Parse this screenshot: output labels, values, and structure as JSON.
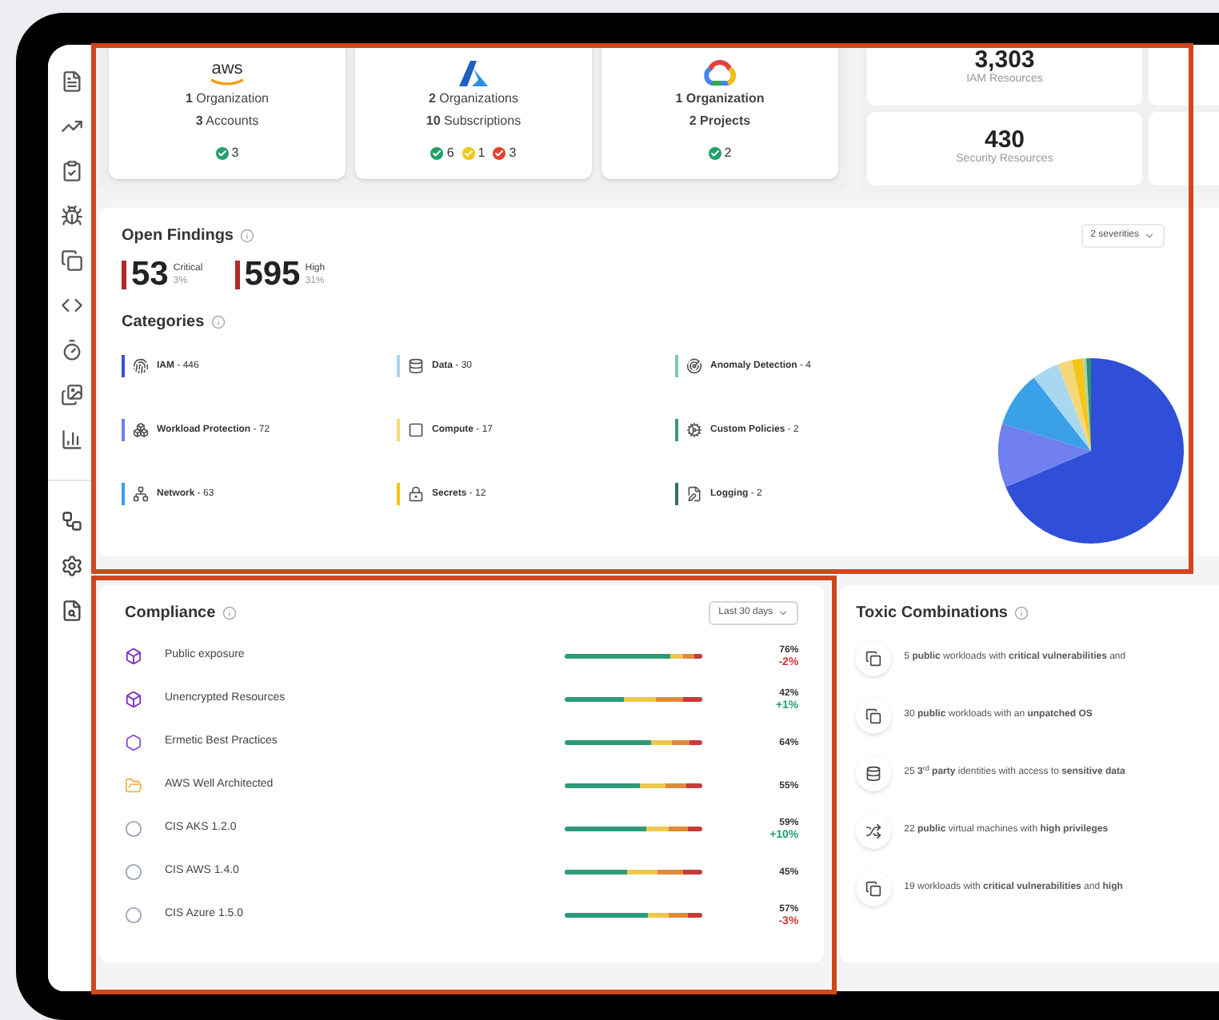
{
  "clouds": [
    {
      "logo_text": "aws",
      "lines": [
        "**1** Organization",
        "**3** Accounts"
      ],
      "statuses": [
        {
          "count": "3",
          "color": "#22a06b"
        }
      ]
    },
    {
      "lines": [
        "**2** Organizations",
        "**10** Subscriptions"
      ],
      "statuses": [
        {
          "count": "6",
          "color": "#22a06b"
        },
        {
          "count": "1",
          "color": "#f5c518"
        },
        {
          "count": "3",
          "color": "#e0412f"
        }
      ]
    },
    {
      "lines": [
        "**1 Organization**",
        "**2 Projects**"
      ],
      "statuses": [
        {
          "count": "2",
          "color": "#22a06b"
        }
      ]
    }
  ],
  "resources": [
    {
      "value": "3,303",
      "label": "IAM Resources"
    },
    {
      "value": "430",
      "label": "Security Resources"
    }
  ],
  "open_findings": {
    "title": "Open Findings",
    "filter": "2 severities",
    "severities": [
      {
        "count": "53",
        "label": "Critical",
        "share": "3%"
      },
      {
        "count": "595",
        "label": "High",
        "share": "31%"
      }
    ],
    "categories_title": "Categories",
    "categories": [
      {
        "label": "**IAM** - 446",
        "color": "#3b4fd8"
      },
      {
        "label": "**Data** - 30",
        "color": "#a8d8f0"
      },
      {
        "label": "**Anomaly Detection** - 4",
        "color": "#7cc9a8"
      },
      {
        "label": "**Workload Protection** - 72",
        "color": "#7080ee"
      },
      {
        "label": "**Compute** - 17",
        "color": "#f5d77a"
      },
      {
        "label": "**Custom Policies** - 2",
        "color": "#3d9a7c"
      },
      {
        "label": "**Network** - 63",
        "color": "#3aa0e8"
      },
      {
        "label": "**Secrets** - 12",
        "color": "#f5c518"
      },
      {
        "label": "**Logging** - 2",
        "color": "#2f6f5f"
      }
    ]
  },
  "compliance": {
    "title": "Compliance",
    "range": "Last 30 days",
    "rows": [
      {
        "name": "Public exposure",
        "level": 0.77,
        "percent": "76%",
        "delta": {
          "text": "-2%",
          "color": "#d33333"
        }
      },
      {
        "name": "Unencrypted Resources",
        "level": 0.43,
        "percent": "42%",
        "delta": {
          "text": "+1%",
          "color": "#22a06b"
        }
      },
      {
        "name": "Ermetic Best Practices",
        "level": 0.63,
        "percent": "64%"
      },
      {
        "name": "AWS Well Architected",
        "level": 0.55,
        "percent": "55%"
      },
      {
        "name": "CIS AKS 1.2.0",
        "level": 0.59,
        "percent": "59%",
        "delta": {
          "text": "+10%",
          "color": "#22a06b"
        }
      },
      {
        "name": "CIS AWS 1.4.0",
        "level": 0.45,
        "percent": "45%"
      },
      {
        "name": "CIS Azure 1.5.0",
        "level": 0.6,
        "percent": "57%",
        "delta": {
          "text": "-3%",
          "color": "#d33333"
        }
      }
    ]
  },
  "toxic_combinations": {
    "title": "Toxic Combinations",
    "items": [
      "5 **public** workloads with **critical vulnerabilities** and",
      "30 **public** workloads with an **unpatched OS**",
      "25 **3**$^{rd}$ **party** identities with access to **sensitive data**",
      "22 **public** virtual machines with **high privileges**",
      "19 workloads with **critical vulnerabilities** and **high**"
    ]
  }
}
